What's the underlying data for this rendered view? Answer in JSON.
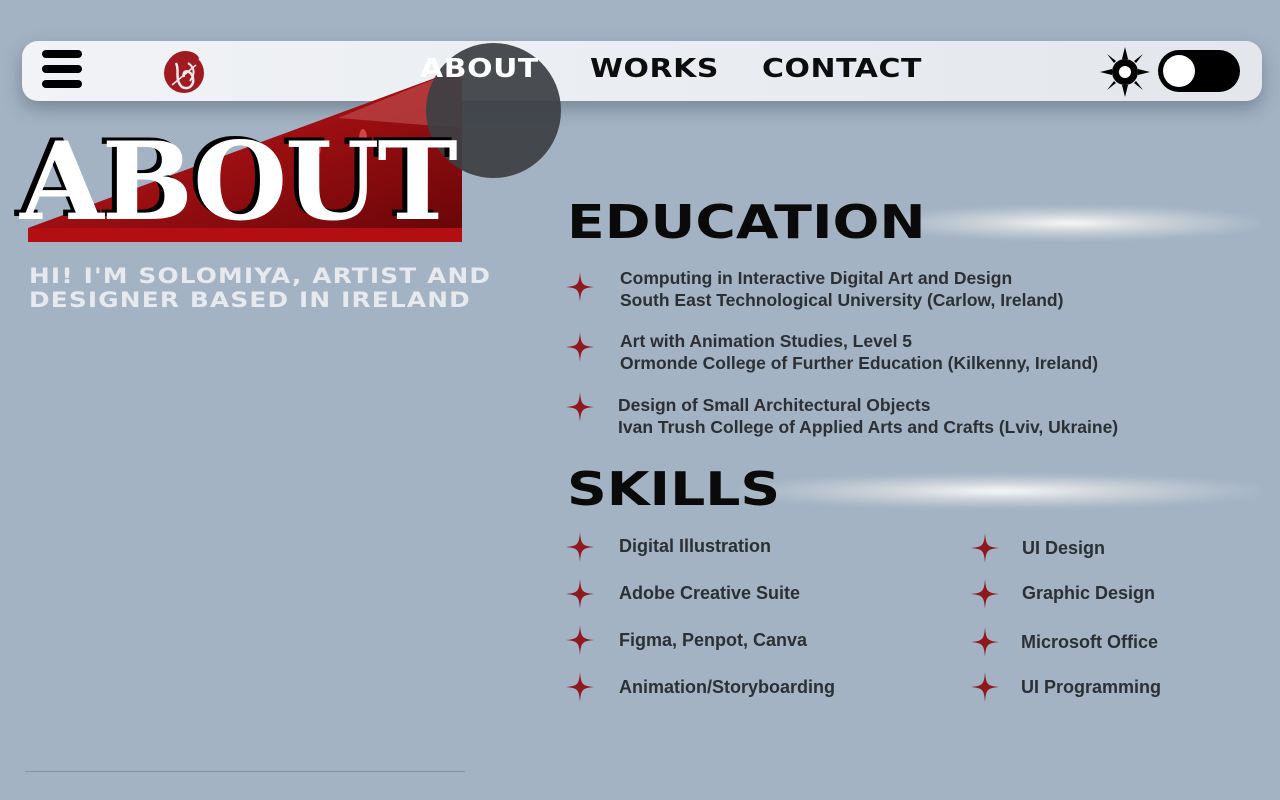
{
  "nav": {
    "links": [
      "ABOUT",
      "WORKS",
      "CONTACT"
    ],
    "active_link": "ABOUT",
    "logo_icon": "brush-monogram-logo",
    "menu_icon": "hamburger-icon",
    "theme_icon": "sun-icon",
    "theme_mode": "light"
  },
  "hero": {
    "title": "ABOUT",
    "subtitle_line1": "HI! I'M SOLOMIYA, ARTIST AND",
    "subtitle_line2": "DESIGNER BASED IN IRELAND"
  },
  "education": {
    "title": "EDUCATION",
    "items": [
      {
        "course": "Computing in Interactive Digital Art and Design",
        "institution": "South East Technological University (Carlow, Ireland)"
      },
      {
        "course": "Art with Animation Studies, Level 5",
        "institution": "Ormonde College of Further Education (Kilkenny, Ireland)"
      },
      {
        "course": "Design of Small Architectural Objects",
        "institution": "Ivan Trush College of Applied Arts and Crafts (Lviv, Ukraine)"
      }
    ]
  },
  "skills": {
    "title": "SKILLS",
    "left": [
      "Digital Illustration",
      "Adobe Creative Suite",
      "Figma, Penpot, Canva",
      "Animation/Storyboarding"
    ],
    "right": [
      "UI Design",
      "Graphic Design",
      "Microsoft Office",
      "UI Programming"
    ]
  },
  "colors": {
    "background": "#a3b3c3",
    "accent_red": "#8e1a1e",
    "nav_bg": "#eceff2",
    "highlight": "#3c3f44",
    "text_dark": "#2c3034"
  }
}
